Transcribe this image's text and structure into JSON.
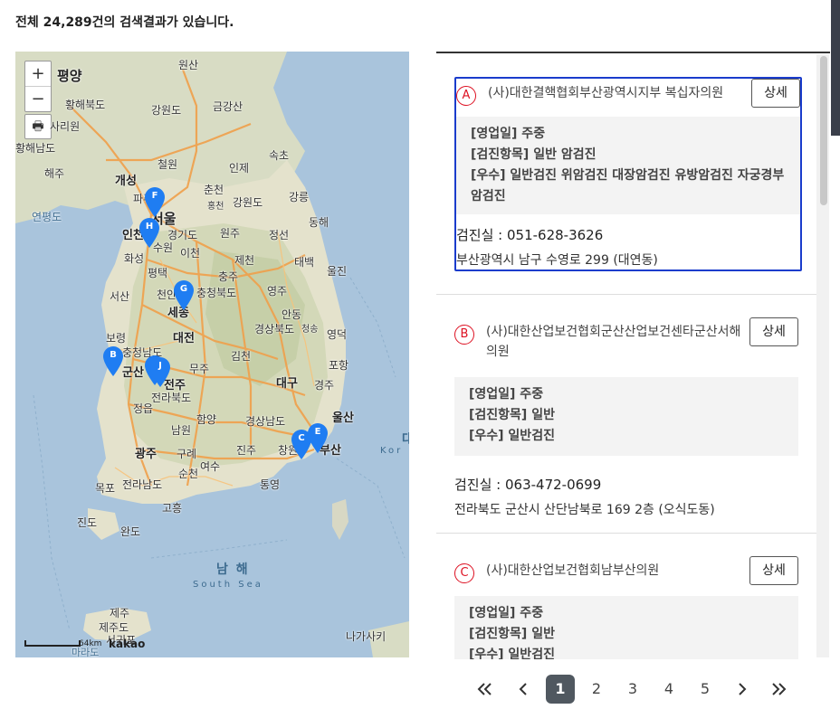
{
  "summary": {
    "prefix": "전체 ",
    "count": "24,289",
    "suffix": "건의 검색결과가 있습니다."
  },
  "map": {
    "zoom_in": "+",
    "zoom_out": "−",
    "print_icon": "printer-icon",
    "labels": {
      "pyongyang": "평양",
      "hwanghaebuk": "황해북도",
      "gangwon_n": "강원도",
      "geumgangsan": "금강산",
      "wonsan": "원산",
      "sariwon": "사리원",
      "hwanghaenam": "황해남도",
      "haeju": "해주",
      "gaesong": "개성",
      "cheorwon": "철원",
      "inje": "인제",
      "sokcho": "속초",
      "chuncheon": "춘천",
      "hongcheon": "홍천",
      "gangwon": "강원도",
      "gangneung": "강릉",
      "donghae": "동해",
      "yeonpyeong": "연평도",
      "paju": "파주",
      "seoul": "서울",
      "incheon": "인천",
      "suwon": "수원",
      "gyeonggi": "경기도",
      "icheon": "이천",
      "wonju": "원주",
      "jeongseon": "정선",
      "hwaseong": "화성",
      "jecheon": "제천",
      "taebaek": "태백",
      "uljin": "울진",
      "pyeongtaek": "평택",
      "chungju": "충주",
      "seosan": "서산",
      "cheonan": "천안",
      "chungbuk": "충청북도",
      "yeongju": "영주",
      "sejong": "세종",
      "andong": "안동",
      "gyeongbuk": "경상북도",
      "cheongsong": "청송",
      "yeongdeok": "영덕",
      "boryeong": "보령",
      "daejeon": "대전",
      "chungnam": "충청남도",
      "gimcheon": "김천",
      "pohang": "포항",
      "gunsan": "군산",
      "muju": "무주",
      "jeonju": "전주",
      "jeonbuk": "전라북도",
      "daegu": "대구",
      "gyeongju": "경주",
      "jeongeup": "정읍",
      "hamyang": "함양",
      "ulsan": "울산",
      "namwon": "남원",
      "gyeongnam": "경상남도",
      "gwangju": "광주",
      "gurye": "구례",
      "jinju": "진주",
      "changwon": "창원",
      "busan": "부산",
      "suncheon": "순천",
      "mokpo": "목포",
      "jeonnam": "전라남도",
      "yeosu": "여수",
      "tongyeong": "통영",
      "goheung": "고흥",
      "jindo": "진도",
      "wando": "완도",
      "korea_strait": "Kor",
      "dae": "대",
      "namhae": "남 해",
      "south_sea": "South Sea",
      "jeju": "제주",
      "jejudo": "제주도",
      "seogwipo": "서귀포",
      "marado": "마라도",
      "nagasaki": "나가사키"
    },
    "markers": [
      "F",
      "H",
      "G",
      "B",
      "J",
      "C",
      "E"
    ],
    "scale": "64km",
    "provider": "kakao"
  },
  "results": [
    {
      "letter": "A",
      "name": "(사)대한결핵협회부산광역시지부 복십자의원",
      "detail_label": "상세",
      "days": "[영업일] 주중",
      "items": "[검진항목] 일반 암검진",
      "excellence": "[우수] 일반검진 위암검진 대장암검진 유방암검진 자궁경부암검진",
      "phone": "검진실 :  051-628-3626",
      "address": "부산광역시 남구 수영로 299 (대연동)"
    },
    {
      "letter": "B",
      "name": "(사)대한산업보건협회군산산업보건센타군산서해의원",
      "detail_label": "상세",
      "days": "[영업일] 주중",
      "items": "[검진항목] 일반",
      "excellence": "[우수] 일반검진",
      "phone": "검진실 :  063-472-0699",
      "address": "전라북도 군산시 산단남북로 169 2층 (오식도동)"
    },
    {
      "letter": "C",
      "name": "(사)대한산업보건협회남부산의원",
      "detail_label": "상세",
      "days": "[영업일] 주중",
      "items": "[검진항목] 일반",
      "excellence": "[우수] 일반검진"
    }
  ],
  "pagination": {
    "first": "«",
    "prev": "‹",
    "pages": [
      "1",
      "2",
      "3",
      "4",
      "5"
    ],
    "current": "1",
    "next": "›",
    "last": "»"
  },
  "colors": {
    "selected_border": "#1a3ccc",
    "letter_red": "#dd1122",
    "marker_blue": "#1f7df2",
    "active_page": "#505860"
  }
}
